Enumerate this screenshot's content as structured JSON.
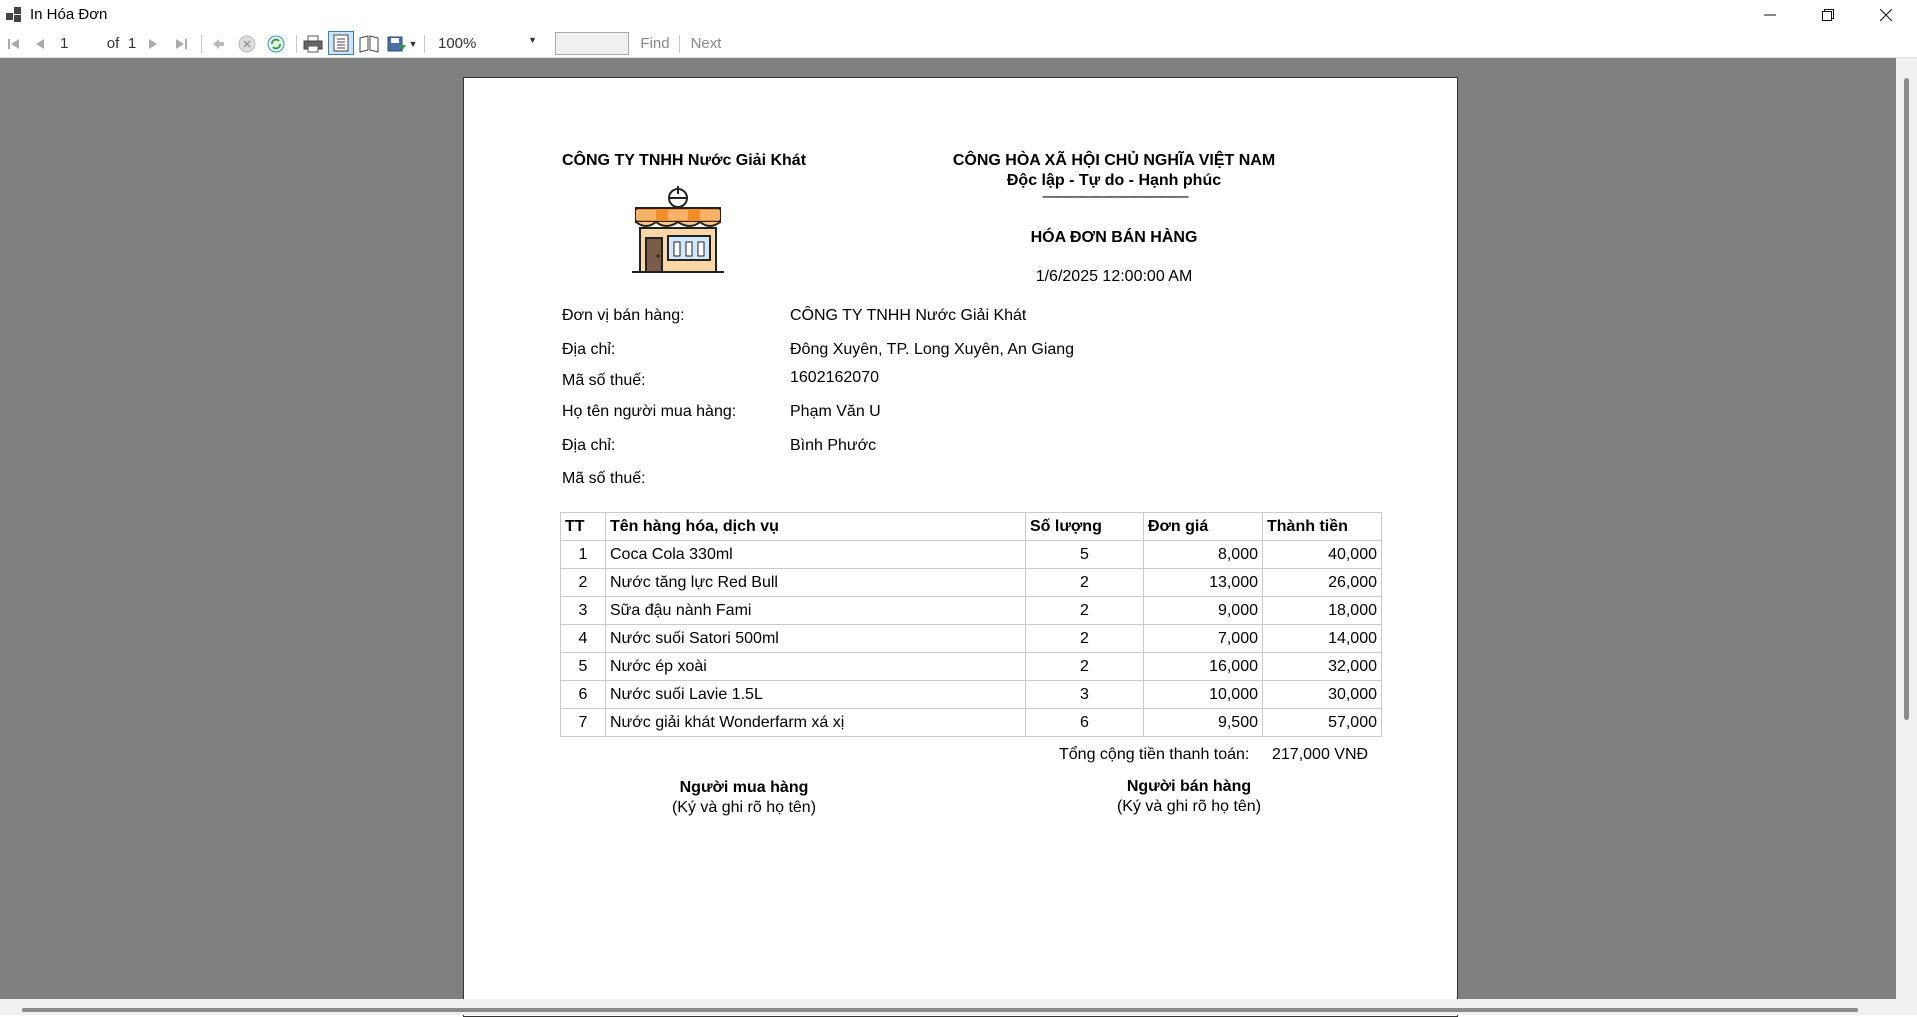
{
  "window": {
    "title": "In Hóa Đơn",
    "min_icon": "minimize-icon",
    "max_icon": "restore-icon",
    "close_icon": "close-icon"
  },
  "toolbar": {
    "current_page": "1",
    "of_label": "of",
    "total_pages": "1",
    "zoom": "100%",
    "find_value": "",
    "find_label": "Find",
    "next_label": "Next"
  },
  "report": {
    "company_header": "CÔNG TY TNHH Nước Giải Khát",
    "nation": "CÔNG HÒA XÃ HỘI CHỦ NGHĨA VIỆT NAM",
    "motto": "Độc lập - Tự do - Hạnh phúc",
    "motto_rule": "———————————",
    "invoice_title": "HÓA ĐƠN BÁN HÀNG",
    "date": "1/6/2025 12:00:00 AM",
    "info": [
      {
        "label": "Đơn vị bán hàng:",
        "value": "CÔNG TY TNHH Nước Giải Khát"
      },
      {
        "label": "Địa chỉ:",
        "value": "Đông Xuyên, TP. Long Xuyên, An Giang"
      },
      {
        "label": "Mã số thuế:",
        "value": "1602162070"
      },
      {
        "label": "Họ tên người mua hàng:",
        "value": "Phạm Văn U"
      },
      {
        "label": "Địa chỉ:",
        "value": "Bình Phước"
      },
      {
        "label": "Mã số thuế:",
        "value": ""
      }
    ],
    "table": {
      "headers": [
        "TT",
        "Tên hàng hóa, dịch vụ",
        "Số lượng",
        "Đơn giá",
        "Thành tiền"
      ],
      "rows": [
        [
          "1",
          "Coca Cola 330ml",
          "5",
          "8,000",
          "40,000"
        ],
        [
          "2",
          "Nước tăng lực Red Bull",
          "2",
          "13,000",
          "26,000"
        ],
        [
          "3",
          "Sữa đậu nành Fami",
          "2",
          "9,000",
          "18,000"
        ],
        [
          "4",
          "Nước suối Satori 500ml",
          "2",
          "7,000",
          "14,000"
        ],
        [
          "5",
          "Nước ép xoài",
          "2",
          "16,000",
          "32,000"
        ],
        [
          "6",
          "Nước suối Lavie 1.5L",
          "3",
          "10,000",
          "30,000"
        ],
        [
          "7",
          "Nước giải khát Wonderfarm xá xị",
          "6",
          "9,500",
          "57,000"
        ]
      ]
    },
    "total_label": "Tổng cộng tiền thanh toán:",
    "total_value": "217,000 VNĐ",
    "buyer_title": "Người mua hàng",
    "buyer_note": "(Ký và ghi rõ họ tên)",
    "seller_title": "Người bán hàng",
    "seller_note": "(Ký và ghi rõ họ tên)"
  }
}
